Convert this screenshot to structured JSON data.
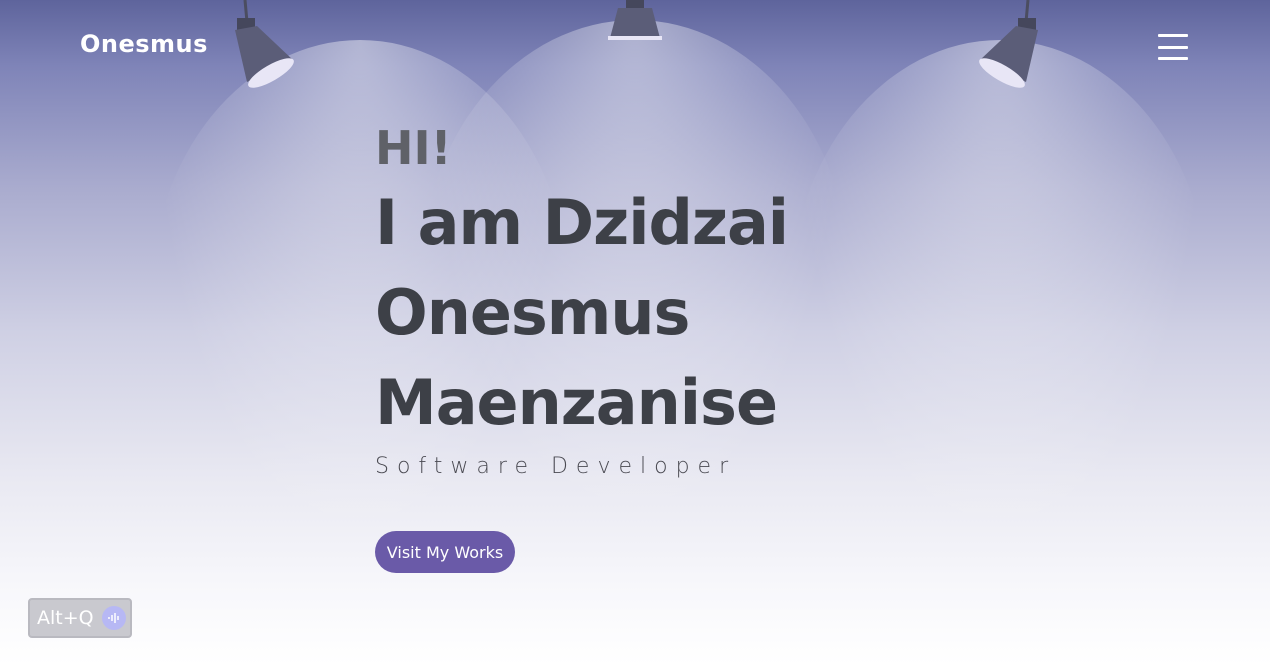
{
  "header": {
    "logo": "Onesmus",
    "menu_icon": "hamburger-menu-icon"
  },
  "hero": {
    "greeting": "HI!",
    "name_line1": "I am Dzidzai",
    "name_line2": "Onesmus",
    "name_line3": "Maenzanise",
    "role": "Software Developer",
    "cta_label": "Visit My Works"
  },
  "shortcut_widget": {
    "label": "Alt+Q",
    "icon": "voice-wave-icon"
  },
  "colors": {
    "accent": "#6a5aa8",
    "heading": "#3d4047",
    "greeting": "#5f6168",
    "background_top": "#5e649c",
    "background_bottom": "#ffffff"
  }
}
